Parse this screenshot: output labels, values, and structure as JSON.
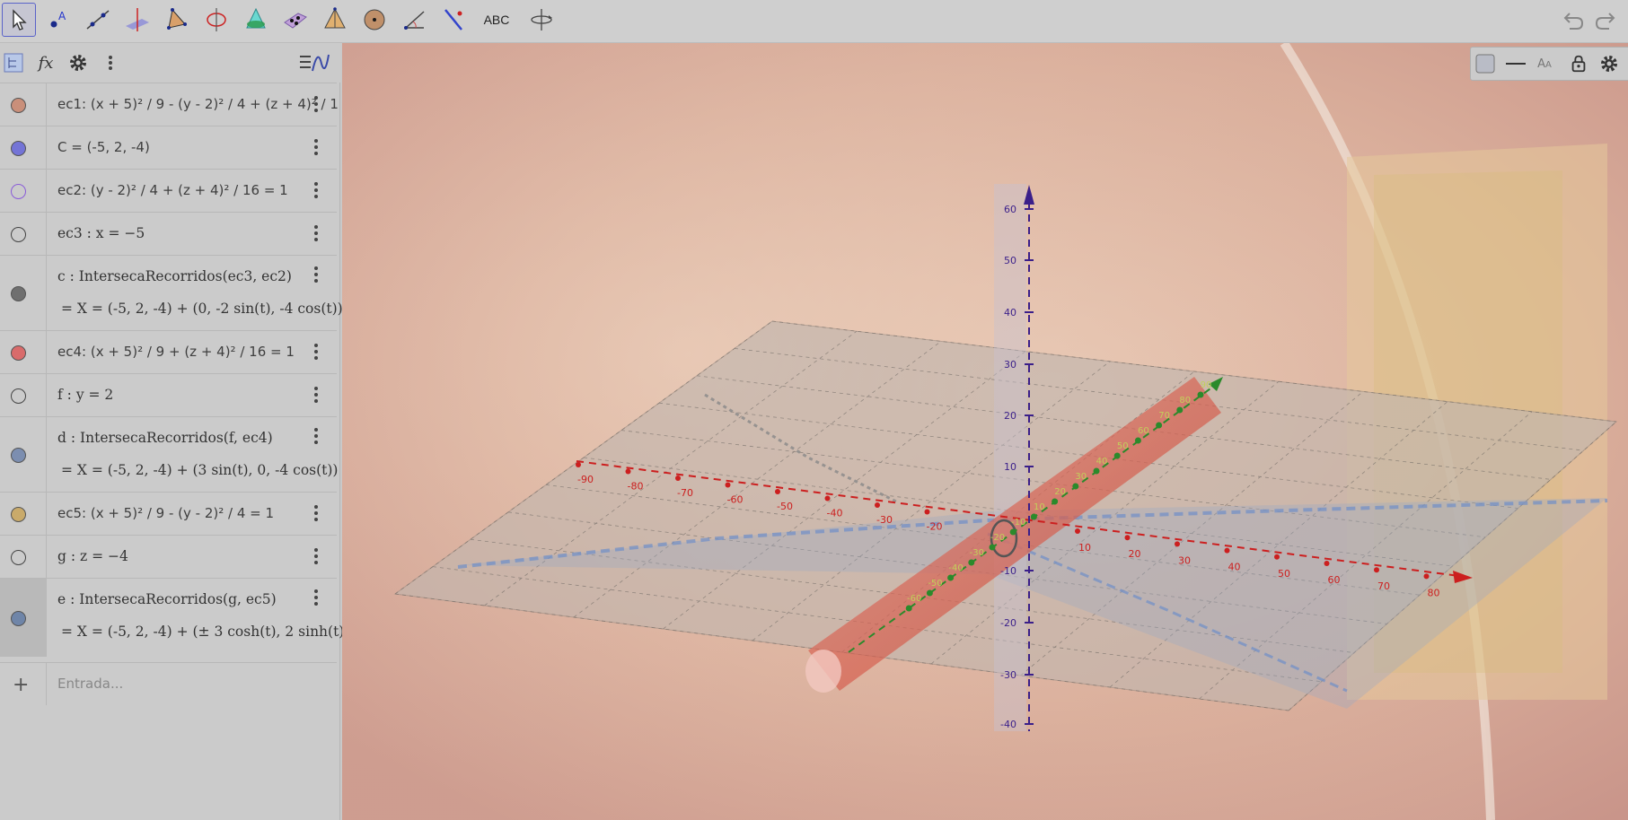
{
  "toolbar": {
    "tools": [
      "move",
      "point",
      "line",
      "perpendicular-line",
      "polygon",
      "circle-around-axis",
      "intersect-surfaces",
      "plane-through-points",
      "pyramid",
      "sphere",
      "angle",
      "reflect",
      "text",
      "rotate-view"
    ],
    "text_tool_label": "ABC"
  },
  "algebra": {
    "rows": [
      {
        "name": "ec1",
        "text": "ec1: (x + 5)² / 9 - (y - 2)² / 4 + (z + 4)² / 1",
        "color": "#c98f7a",
        "filled": true
      },
      {
        "name": "C",
        "text": "C = (-5, 2, -4)",
        "color": "#7474d6",
        "filled": true
      },
      {
        "name": "ec2",
        "text": "ec2: (y - 2)² / 4 + (z + 4)² / 16 = 1",
        "color": "#8a5cd8",
        "filled": false
      },
      {
        "name": "ec3",
        "text": "ec3 : x = −5",
        "color": "#444444",
        "filled": false
      },
      {
        "name": "c",
        "text": "c : IntersecaRecorridos(ec3, ec2)",
        "result": "=  X = (-5, 2, -4) + (0, -2 sin(t), -4 cos(t))",
        "color": "#6f6f6f",
        "filled": true
      },
      {
        "name": "ec4",
        "text": "ec4: (x + 5)² / 9 + (z + 4)² / 16 = 1",
        "color": "#d96b6b",
        "filled": true
      },
      {
        "name": "f",
        "text": "f : y = 2",
        "color": "#444444",
        "filled": false
      },
      {
        "name": "d",
        "text": "d : IntersecaRecorridos(f, ec4)",
        "result": "=  X = (-5, 2, -4) + (3 sin(t), 0, -4 cos(t))",
        "color": "#7c8eb0",
        "filled": true
      },
      {
        "name": "ec5",
        "text": "ec5: (x + 5)² / 9 - (y - 2)² / 4 = 1",
        "color": "#c9aa6a",
        "filled": true
      },
      {
        "name": "g",
        "text": "g : z = −4",
        "color": "#444444",
        "filled": false
      },
      {
        "name": "e",
        "text": "e : IntersecaRecorridos(g, ec5)",
        "result": "=  X = (-5, 2, -4) + (± 3 cosh(t), 2 sinh(t),",
        "color": "#6f85a8",
        "filled": true
      }
    ],
    "input_placeholder": "Entrada..."
  },
  "axes": {
    "z_ticks": [
      "60",
      "50",
      "40",
      "30",
      "20",
      "10",
      "-10",
      "-20",
      "-30",
      "-40"
    ],
    "x_ticks_neg": [
      "-90",
      "-80",
      "-70",
      "-60",
      "-50",
      "-40",
      "-30",
      "-20"
    ],
    "x_ticks_pos": [
      "10",
      "20",
      "30",
      "40",
      "50",
      "60",
      "70",
      "80"
    ],
    "y_ticks": [
      "90",
      "80",
      "70",
      "60",
      "50",
      "40",
      "30",
      "20",
      "10",
      "-10",
      "-20",
      "-30",
      "-40",
      "-50",
      "-60"
    ],
    "colors": {
      "x": "#cc1f1f",
      "y": "#2b8a2b",
      "z": "#3a1f8a"
    }
  }
}
